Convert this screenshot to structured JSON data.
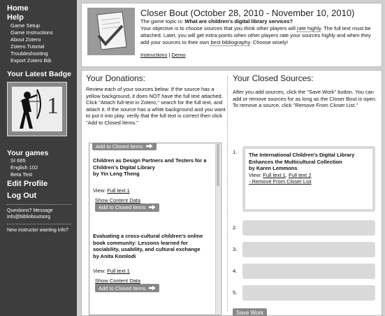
{
  "sidebar": {
    "home": "Home",
    "help": "Help",
    "help_items": [
      "Game Setup",
      "Game Instructions",
      "About Zotero",
      "Zotero Tutorial",
      "Troubleshooting",
      "Export Zotero Bib"
    ],
    "badge_title": "Your Latest Badge",
    "badge_number": "1",
    "games_title": "Your games",
    "games": [
      "SI 665",
      "English 102",
      "Beta Test"
    ],
    "edit_profile": "Edit Profile",
    "logout": "Log Out",
    "questions": "Questions? Message",
    "email": "info@biblioboutsorg",
    "new_instructor": "New instructor wanting info?"
  },
  "header": {
    "title": "Closer Bout (October 28, 2010 - November 10, 2010)",
    "topic_prefix": "The game topic is: ",
    "topic": "What are children's digital library services?",
    "desc_1": "Your objective is to choose sources that you think other players will ",
    "rate_highly": "rate highly",
    "desc_2": ". The full text must be attached. Later, you will get extra points when other players rate your sources highly and when they add your sources to their own ",
    "best_bibliography": "best bibliography",
    "desc_3": ". Choose wisely!",
    "instructions": "Instructions",
    "sep": " | ",
    "demo": "Demo"
  },
  "donations": {
    "title": "Your Donations:",
    "instructions": "Review each of your sources below. If the source has a yellow background, it does NOT have the full text attached. Click \"Attach full-text in Zotero,\" search for the full text, and attach it. If the source has a white background and you want to put it into play, verify that the full text is correct then click \"Add to Closed Items.\"",
    "add_label": "Add to Closed Items",
    "items": [
      {
        "title": "Children as Design Partners and Testers for a Children's Digital Library",
        "author": "by Yin Leng Theng",
        "view": "View: ",
        "link": "Full text 1",
        "show": "Show Content Data"
      },
      {
        "title": "Evaluating a cross-cultural children's online book community: Lessons learned for sociability, usability, and cultural exchange",
        "author": "by Anita Komlodi",
        "view": "View: ",
        "link": "Full text 1",
        "show": "Show Content Data"
      }
    ]
  },
  "closed": {
    "title": "Your Closed Sources:",
    "instructions": "After you add sources, click the \"Save Work\" button. You can add or remove sources for as long as the Closer Bout is open. To remove a source, click \"Remove From Closer List.\"",
    "slot1": {
      "num": "1.",
      "title": "The International Children's Digital Library Enhances the Multicultural Collection",
      "author": "by Karen Lemmons",
      "view": "View: ",
      "link1": "Full text 1",
      "comma": ", ",
      "link2": "Full text 2",
      "remove": "- Remove From Closer List"
    },
    "empty_slots": [
      "2.",
      "3.",
      "4.",
      "5."
    ],
    "save": "Save Work"
  }
}
